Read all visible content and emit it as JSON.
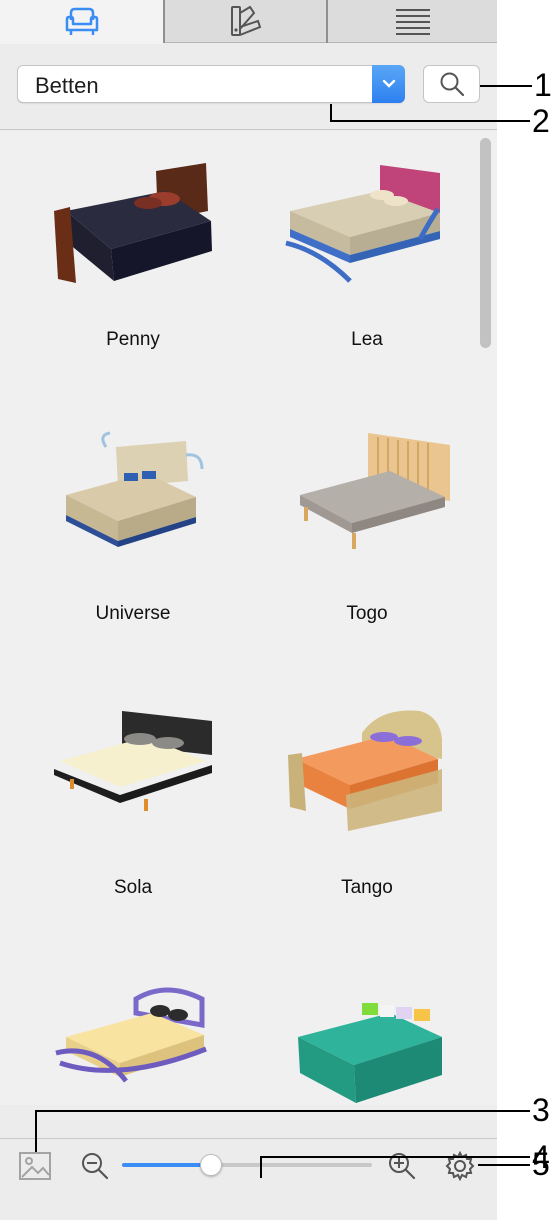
{
  "tabs": [
    {
      "name": "furniture",
      "icon": "armchair-icon",
      "active": true
    },
    {
      "name": "textures",
      "icon": "color-swatches-icon",
      "active": false
    },
    {
      "name": "list",
      "icon": "list-icon",
      "active": false
    }
  ],
  "category_select": {
    "value": "Betten"
  },
  "search_button": {
    "icon": "magnifier-icon"
  },
  "catalog": {
    "items": [
      {
        "label": "Penny"
      },
      {
        "label": "Lea"
      },
      {
        "label": "Universe"
      },
      {
        "label": "Togo"
      },
      {
        "label": "Sola"
      },
      {
        "label": "Tango"
      },
      {
        "label": ""
      },
      {
        "label": ""
      }
    ]
  },
  "bottom_bar": {
    "image_icon": "image-icon",
    "zoom_out_icon": "zoom-out-icon",
    "zoom_in_icon": "zoom-in-icon",
    "settings_icon": "gear-icon",
    "zoom_level": 0.35
  },
  "callouts": {
    "c1": "1",
    "c2": "2",
    "c3": "3",
    "c4": "4",
    "c5": "5"
  },
  "colors": {
    "accent": "#3a8df5",
    "panel_bg": "#ececec"
  }
}
